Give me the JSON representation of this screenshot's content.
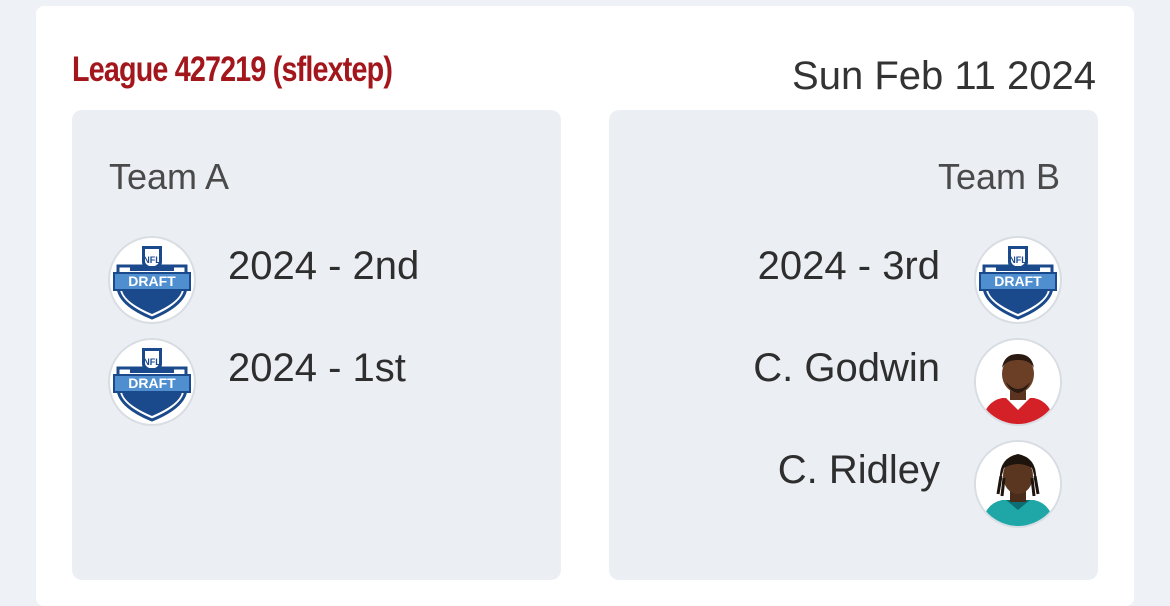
{
  "header": {
    "league_title": "League 427219 (sflextep)",
    "date": "Sun Feb 11 2024"
  },
  "colors": {
    "accent": "#a3161b",
    "panel_bg": "#ebeff4",
    "page_bg": "#eef1f5"
  },
  "team_a": {
    "label": "Team A",
    "assets": [
      {
        "text": "2024 - 2nd",
        "icon": "nfl-draft-logo-icon"
      },
      {
        "text": "2024 - 1st",
        "icon": "nfl-draft-logo-icon"
      }
    ]
  },
  "team_b": {
    "label": "Team B",
    "assets": [
      {
        "text": "2024 - 3rd",
        "icon": "nfl-draft-logo-icon"
      },
      {
        "text": "C. Godwin",
        "icon": "player-headshot-icon"
      },
      {
        "text": "C. Ridley",
        "icon": "player-headshot-icon"
      }
    ]
  },
  "draft_logo": {
    "top_text": "NFL",
    "banner_text": "DRAFT"
  }
}
